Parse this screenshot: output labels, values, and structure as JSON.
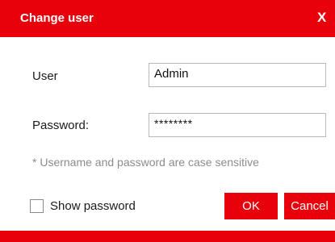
{
  "dialog": {
    "title": "Change user",
    "close_label": "X"
  },
  "form": {
    "user_label": "User",
    "user_value": "Admin",
    "password_label": "Password:",
    "password_value": "********",
    "note": "* Username and password are case sensitive",
    "show_password_label": "Show password",
    "show_password_checked": false
  },
  "buttons": {
    "ok_label": "OK",
    "cancel_label": "Cancel"
  },
  "colors": {
    "accent": "#e8000b",
    "note_text": "#8c8c8c"
  }
}
